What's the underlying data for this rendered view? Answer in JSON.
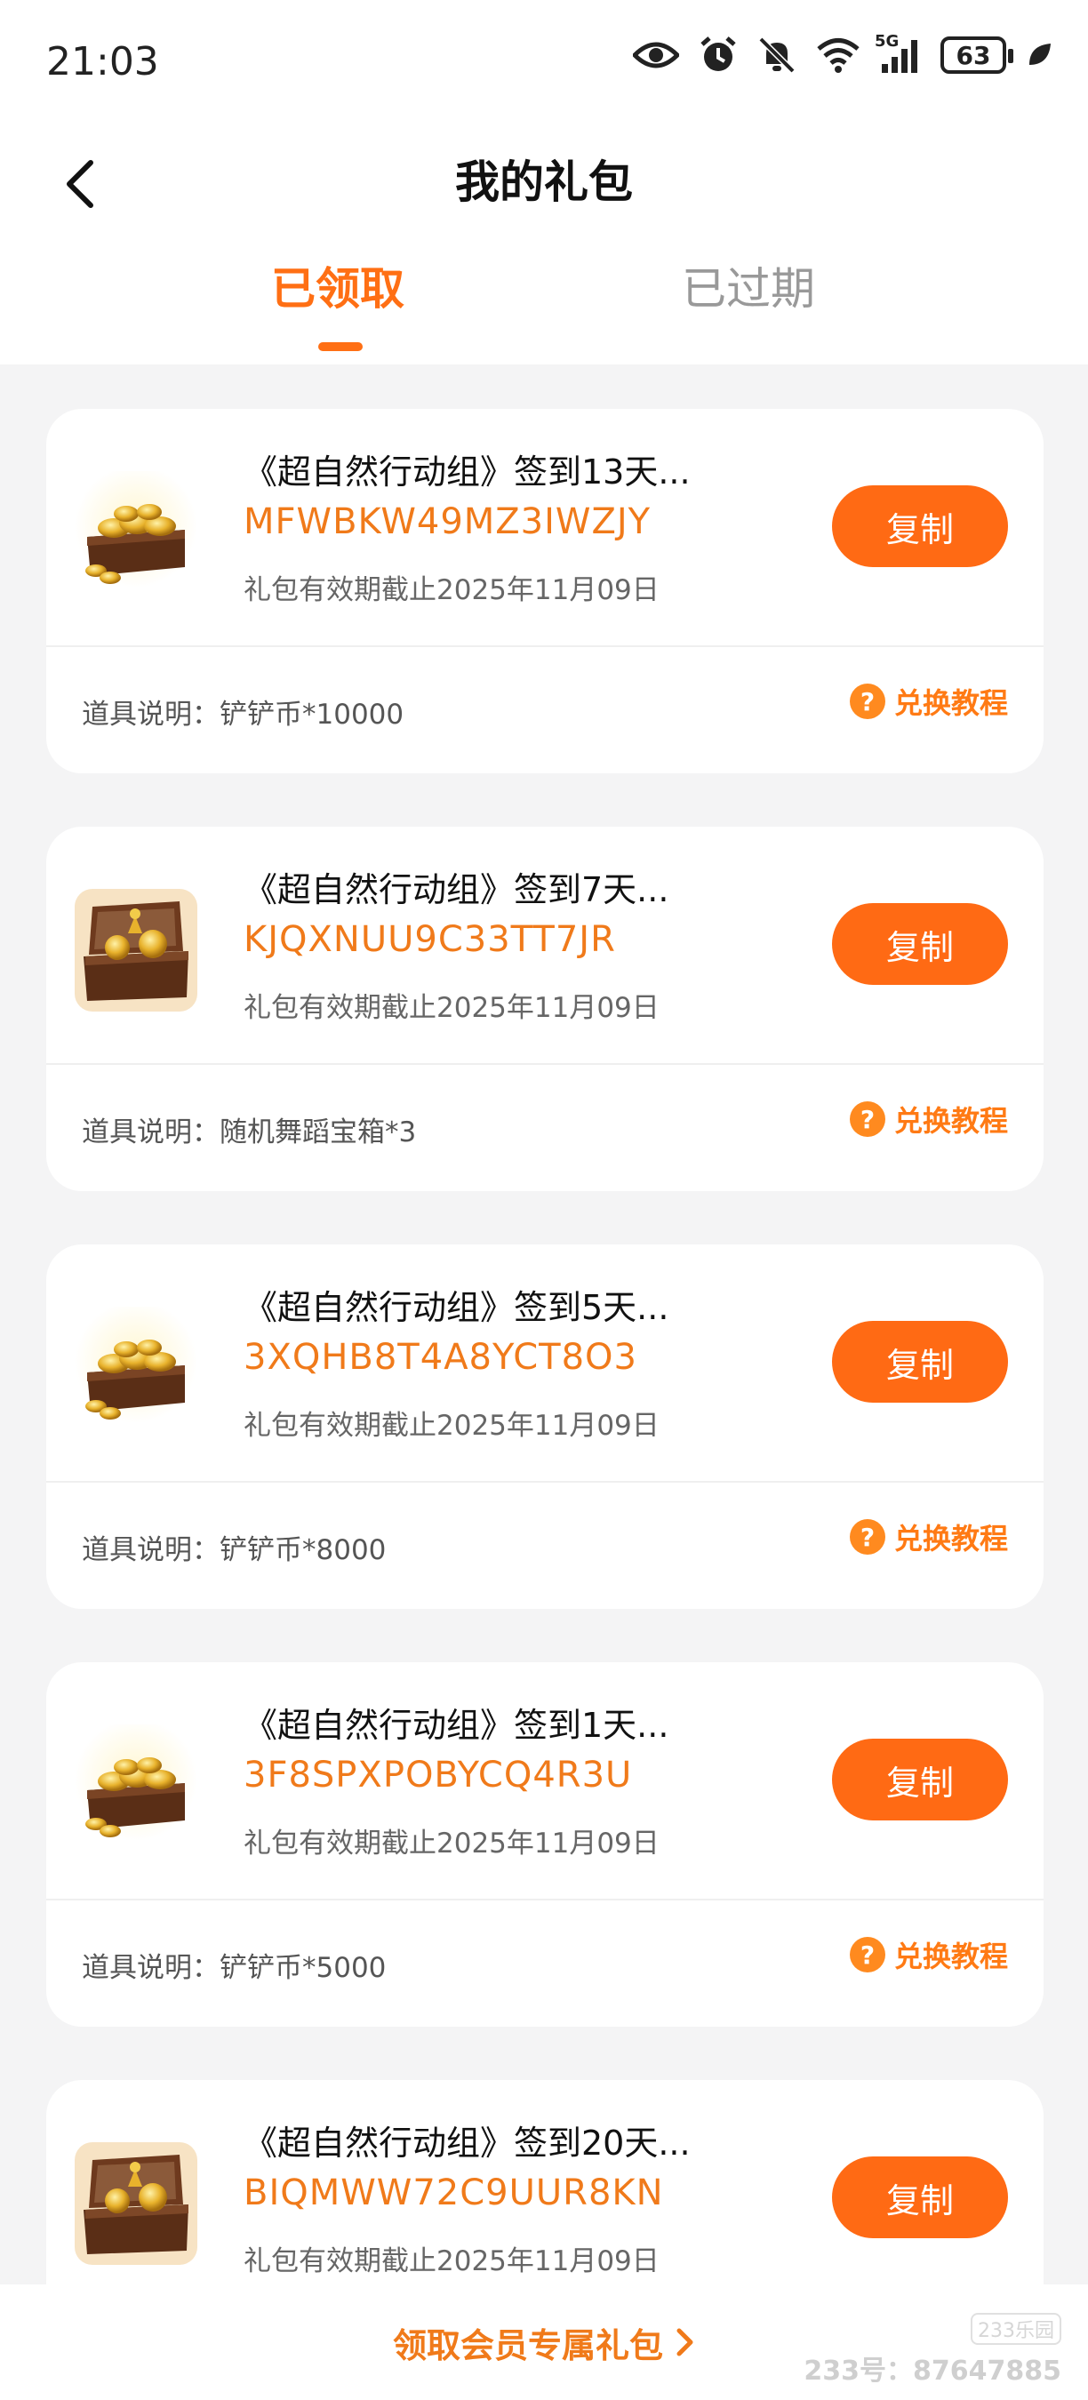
{
  "status_bar": {
    "time": "21:03",
    "network": "5G",
    "battery": "63",
    "icons": [
      "eye-icon",
      "alarm-icon",
      "bell-off-icon",
      "wifi-icon",
      "signal-icon",
      "battery-icon",
      "leaf-icon"
    ]
  },
  "header": {
    "title": "我的礼包",
    "back_icon": "chevron-left-icon"
  },
  "tabs": [
    {
      "label": "已领取",
      "active": true
    },
    {
      "label": "已过期",
      "active": false
    }
  ],
  "gifts": [
    {
      "name": "《超自然行动组》签到13天...",
      "code": "MFWBKW49MZ3IWZJY",
      "expiry": "礼包有效期截止2025年11月09日",
      "copy_label": "复制",
      "description": "道具说明：铲铲币*10000",
      "tutorial_label": "兑换教程",
      "thumb": "gold-coin-chest"
    },
    {
      "name": "《超自然行动组》签到7天...",
      "code": "KJQXNUU9C33TT7JR",
      "expiry": "礼包有效期截止2025年11月09日",
      "copy_label": "复制",
      "description": "道具说明：随机舞蹈宝箱*3",
      "tutorial_label": "兑换教程",
      "thumb": "dance-chest"
    },
    {
      "name": "《超自然行动组》签到5天...",
      "code": "3XQHB8T4A8YCT8O3",
      "expiry": "礼包有效期截止2025年11月09日",
      "copy_label": "复制",
      "description": "道具说明：铲铲币*8000",
      "tutorial_label": "兑换教程",
      "thumb": "gold-coin-chest"
    },
    {
      "name": "《超自然行动组》签到1天...",
      "code": "3F8SPXPOBYCQ4R3U",
      "expiry": "礼包有效期截止2025年11月09日",
      "copy_label": "复制",
      "description": "道具说明：铲铲币*5000",
      "tutorial_label": "兑换教程",
      "thumb": "gold-coin-chest"
    },
    {
      "name": "《超自然行动组》签到20天...",
      "code": "BIQMWW72C9UUR8KN",
      "expiry": "礼包有效期截止2025年11月09日",
      "copy_label": "复制",
      "description": "",
      "tutorial_label": "",
      "thumb": "dance-chest"
    }
  ],
  "bottom": {
    "member_link": "领取会员专属礼包",
    "watermark_logo": "233乐园",
    "watermark_text": "233号：87647885"
  },
  "colors": {
    "accent": "#ff6a14",
    "code_text": "#f07a1a",
    "background": "#f4f4f5"
  }
}
